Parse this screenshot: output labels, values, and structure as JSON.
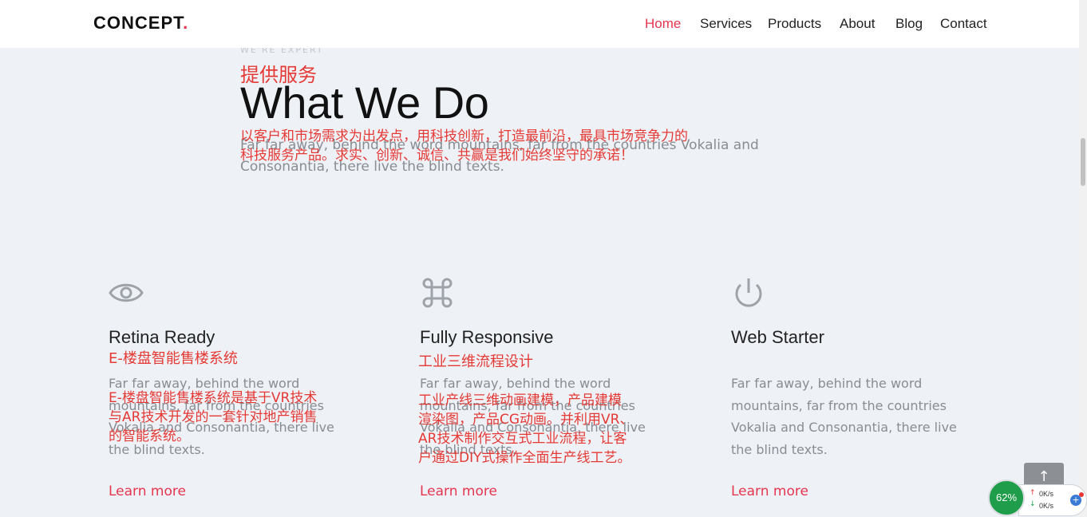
{
  "brand": {
    "name": "CONCEPT",
    "dot": "."
  },
  "nav": [
    {
      "label": "Home",
      "active": true
    },
    {
      "label": "Services",
      "active": false
    },
    {
      "label": "Products",
      "active": false
    },
    {
      "label": "About",
      "active": false
    },
    {
      "label": "Blog",
      "active": false
    },
    {
      "label": "Contact",
      "active": false
    }
  ],
  "hero": {
    "eyebrow": "WE'RE EXPERT",
    "cn_title": "提供服务",
    "title": "What We Do",
    "lead": "Far far away, behind the word mountains, far from the countries Vokalia and Consonantia, there live the blind texts.",
    "cn_lead_1": "以客户和市场需求为出发点，用科技创新，打造最前沿，最具市场竞争力的",
    "cn_lead_2": "科技服务产品。求实、创新、诚信、共赢是我们始终坚守的承诺！"
  },
  "features": [
    {
      "icon": "eye-icon",
      "title": "Retina Ready",
      "cn_title": "E-楼盘智能售楼系统",
      "body": "Far far away, behind the word mountains, far from the countries Vokalia and Consonantia, there live the blind texts.",
      "cn_body_1": "E-楼盘智能售楼系统是基于VR技术",
      "cn_body_2": "与AR技术开发的一套针对地产销售",
      "cn_body_3": "的智能系统。",
      "link": "Learn more"
    },
    {
      "icon": "command-icon",
      "title": "Fully Responsive",
      "cn_title": "工业三维流程设计",
      "body": "Far far away, behind the word mountains, far from the countries Vokalia and Consonantia, there live the blind texts.",
      "cn_body_1": "工业产线三维动画建模，产品建模",
      "cn_body_2": "渲染图，产品CG动画。并利用VR、",
      "cn_body_3": "AR技术制作交互式工业流程，让客",
      "cn_body_4": "户通过DIY式操作全面生产线工艺。",
      "link": "Learn more"
    },
    {
      "icon": "power-icon",
      "title": "Web Starter",
      "body": "Far far away, behind the word mountains, far from the countries Vokalia and Consonantia, there live the blind texts.",
      "link": "Learn more"
    }
  ],
  "back_to_top": {
    "icon": "arrow-up-icon",
    "label": "↑"
  },
  "net_widget": {
    "percent": "62%",
    "upload": "0K/s",
    "download": "0K/s",
    "plus": "+"
  },
  "colors": {
    "accent": "#e5354f",
    "cn_red": "#e53935",
    "bg": "#eef2f6"
  }
}
